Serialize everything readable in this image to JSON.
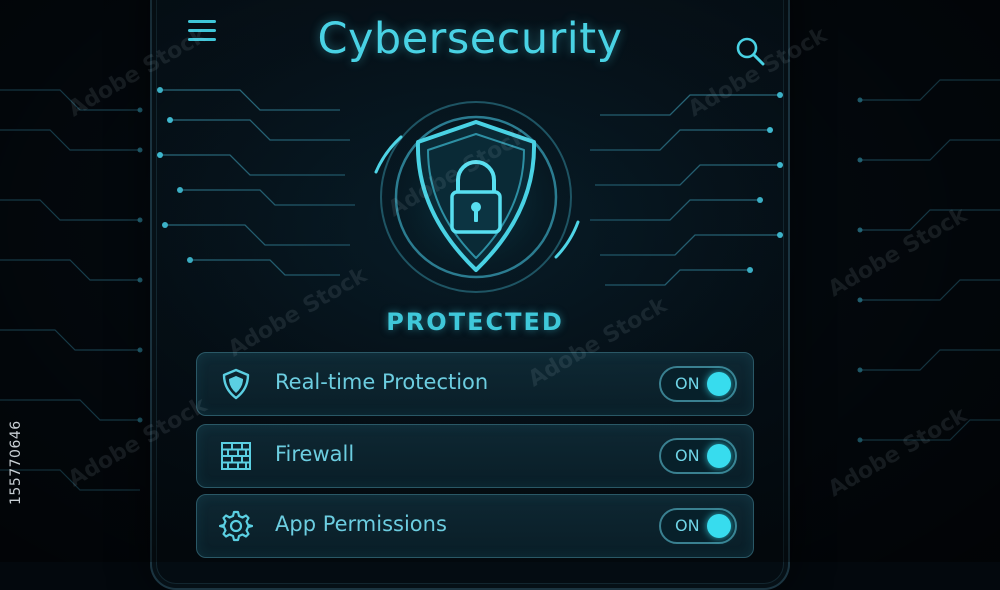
{
  "header": {
    "title": "Cybersecurity",
    "menu_icon": "hamburger-menu-icon",
    "search_icon": "search-icon"
  },
  "hero": {
    "icon": "shield-lock-icon",
    "status": "PROTECTED"
  },
  "settings": [
    {
      "label": "Real-time Protection",
      "icon": "shield-icon",
      "toggle": "ON",
      "enabled": true
    },
    {
      "label": "Firewall",
      "icon": "firewall-brick-icon",
      "toggle": "ON",
      "enabled": true
    },
    {
      "label": "App Permissions",
      "icon": "gear-icon",
      "toggle": "ON",
      "enabled": true
    }
  ],
  "watermark": {
    "stock_id": "155770646",
    "text": "Adobe Stock"
  },
  "colors": {
    "accent": "#49d2e4",
    "knob": "#37dcee",
    "background": "#03080d",
    "row_border": "#2a5866"
  }
}
